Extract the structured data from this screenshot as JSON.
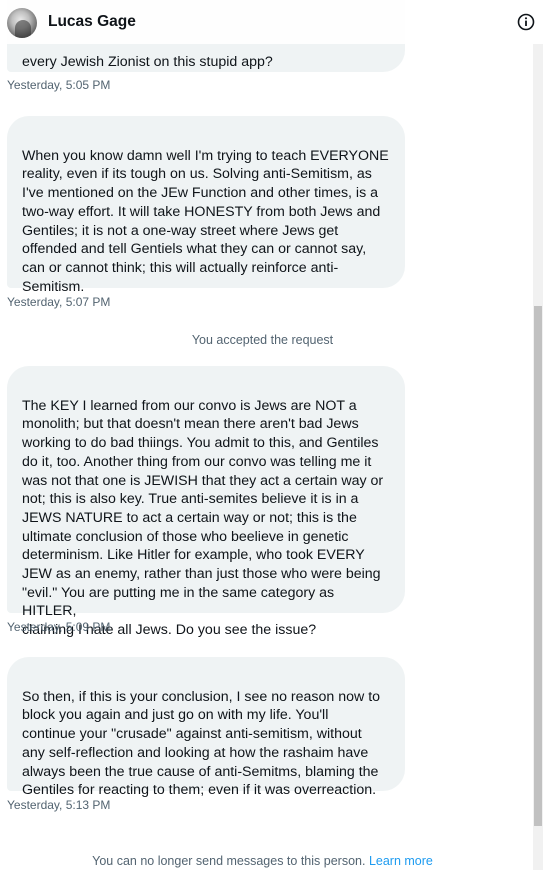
{
  "header": {
    "name": "Lucas Gage"
  },
  "messages": [
    {
      "text": "every Jewish Zionist on this stupid app?",
      "time": "Yesterday, 5:05 PM"
    },
    {
      "text": "When you know damn well I'm trying to teach EVERYONE\nreality, even if its tough on us. Solving anti-Semitism, as\nI've mentioned on the JEw Function and other times, is a\ntwo-way effort. It will take HONESTY from both Jews and\nGentiles; it is not a one-way street where Jews get\noffended and tell Gentiels what they can or cannot say,\ncan or cannot think; this will actually reinforce anti-\nSemitism.",
      "time": "Yesterday, 5:07 PM"
    },
    {
      "text": "The KEY I learned from our convo is Jews are NOT a\nmonolith; but that doesn't mean there aren't bad Jews\nworking to do bad thiings. You admit to this, and Gentiles\ndo it, too. Another thing from our convo was telling me it\nwas not that one is JEWISH that they act a certain way or\nnot; this is also key. True anti-semites believe it is in a\nJEWS NATURE to act a certain way or not; this is the\nultimate conclusion of those who beelieve in genetic\ndeterminism. Like Hitler for example, who took EVERY\nJEW as an enemy, rather than just those who were being\n\"evil.\" You are putting me in the same category as HITLER,\nclaiming I hate all Jews. Do you see the issue?",
      "time": "Yesterday, 5:09 PM"
    },
    {
      "text": "So then, if this is your conclusion, I see no reason now to\nblock you again and just go on with my life. You'll\ncontinue your \"crusade\" against anti-semitism, without\nany self-reflection and looking at how the rashaim have\nalways been the true cause of anti-Semitms, blaming the\nGentiles for reacting to them; even if it was overreaction.",
      "time": "Yesterday, 5:13 PM"
    }
  ],
  "system_notice": "You accepted the request",
  "footer": {
    "text": "You can no longer send messages to this person.",
    "link": "Learn more"
  },
  "icons": {
    "info": "info-circle-icon"
  }
}
